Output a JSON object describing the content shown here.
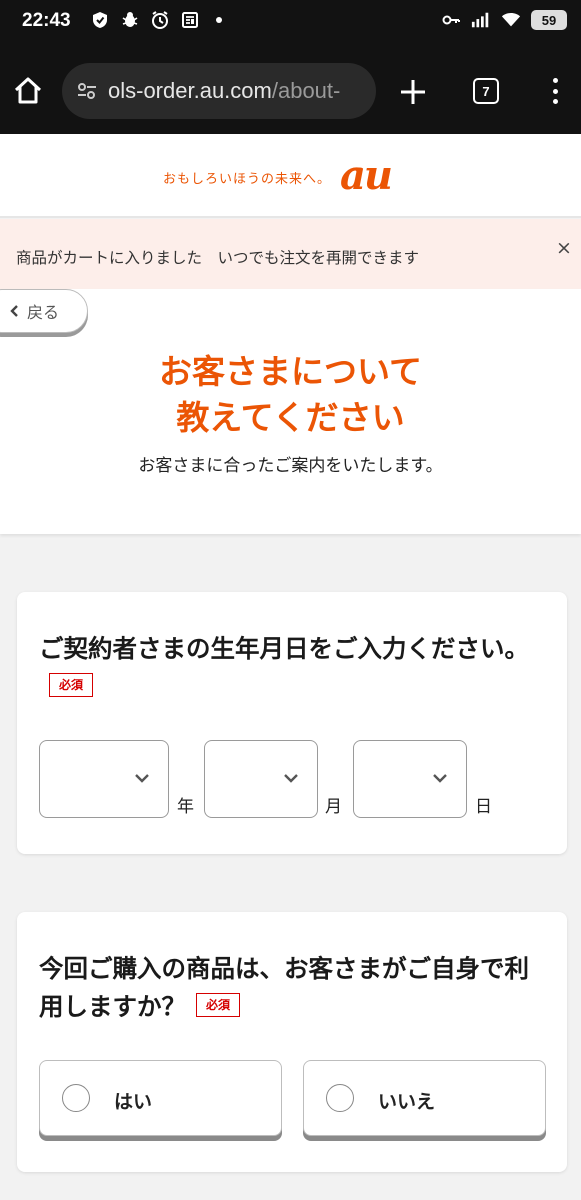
{
  "status_bar": {
    "time": "22:43",
    "battery": "59",
    "icons_left": [
      "shield-icon",
      "bug-icon",
      "alarm-icon",
      "news-icon"
    ],
    "icons_right": [
      "key-icon",
      "signal-icon",
      "wifi-icon",
      "battery-icon"
    ]
  },
  "browser": {
    "url_host": "ols-order.au.com",
    "url_path": "/about-",
    "tab_count": "7"
  },
  "header": {
    "tagline": "おもしろいほうの未来へ。",
    "logo": "au",
    "brand_color": "#eb5505"
  },
  "notice": {
    "text": "商品がカートに入りました　いつでも注文を再開できます",
    "close": "×"
  },
  "intro": {
    "back_label": "戻る",
    "headline_line1": "お客さまについて",
    "headline_line2": "教えてください",
    "subline": "お客さまに合ったご案内をいたします。"
  },
  "birthdate": {
    "question": "ご契約者さまの生年月日をご入力ください。",
    "required": "必須",
    "year_unit": "年",
    "month_unit": "月",
    "day_unit": "日",
    "year_value": "",
    "month_value": "",
    "day_value": ""
  },
  "usage": {
    "question": "今回ご購入の商品は、お客さまがご自身で利用しますか？",
    "required": "必須",
    "options": [
      "はい",
      "いいえ"
    ]
  }
}
